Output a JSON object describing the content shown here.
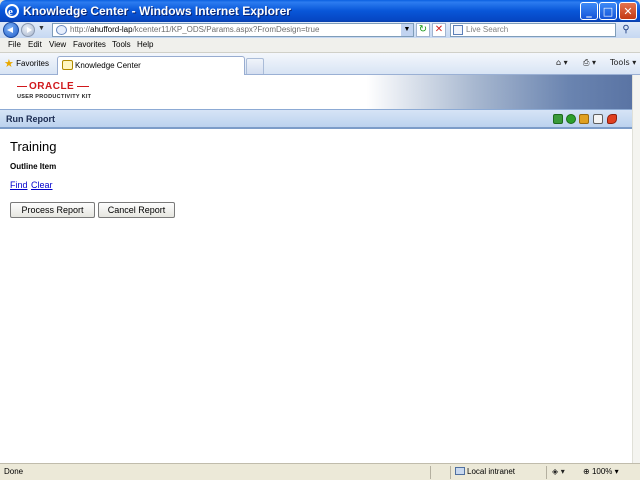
{
  "window": {
    "title": "Knowledge Center - Windows Internet Explorer",
    "min_glyph": "_",
    "max_glyph": "□",
    "close_glyph": "✕"
  },
  "address": {
    "url_prefix": "http://",
    "url_host": "ahufford-lap",
    "url_path": "/kcenter11/KP_ODS/Params.aspx?FromDesign=true",
    "search_placeholder": "Live Search"
  },
  "menu": [
    "File",
    "Edit",
    "View",
    "Favorites",
    "Tools",
    "Help"
  ],
  "favorites_label": "Favorites",
  "tab": {
    "label": "Knowledge Center"
  },
  "commands": {
    "tools_label": "Tools"
  },
  "banner": {
    "brand": "ORACLE",
    "product": "USER PRODUCTIVITY KIT"
  },
  "section": {
    "title": "Run Report"
  },
  "content": {
    "heading": "Training",
    "outline_label": "Outline Item",
    "find_link": "Find",
    "clear_link": "Clear",
    "process_button": "Process Report",
    "cancel_button": "Cancel Report"
  },
  "status": {
    "text": "Done",
    "zone": "Local intranet",
    "zoom": "100%"
  },
  "colors": {
    "titlebar": "#0856d8",
    "oracle_red": "#d0181c",
    "link": "#0000cc"
  }
}
